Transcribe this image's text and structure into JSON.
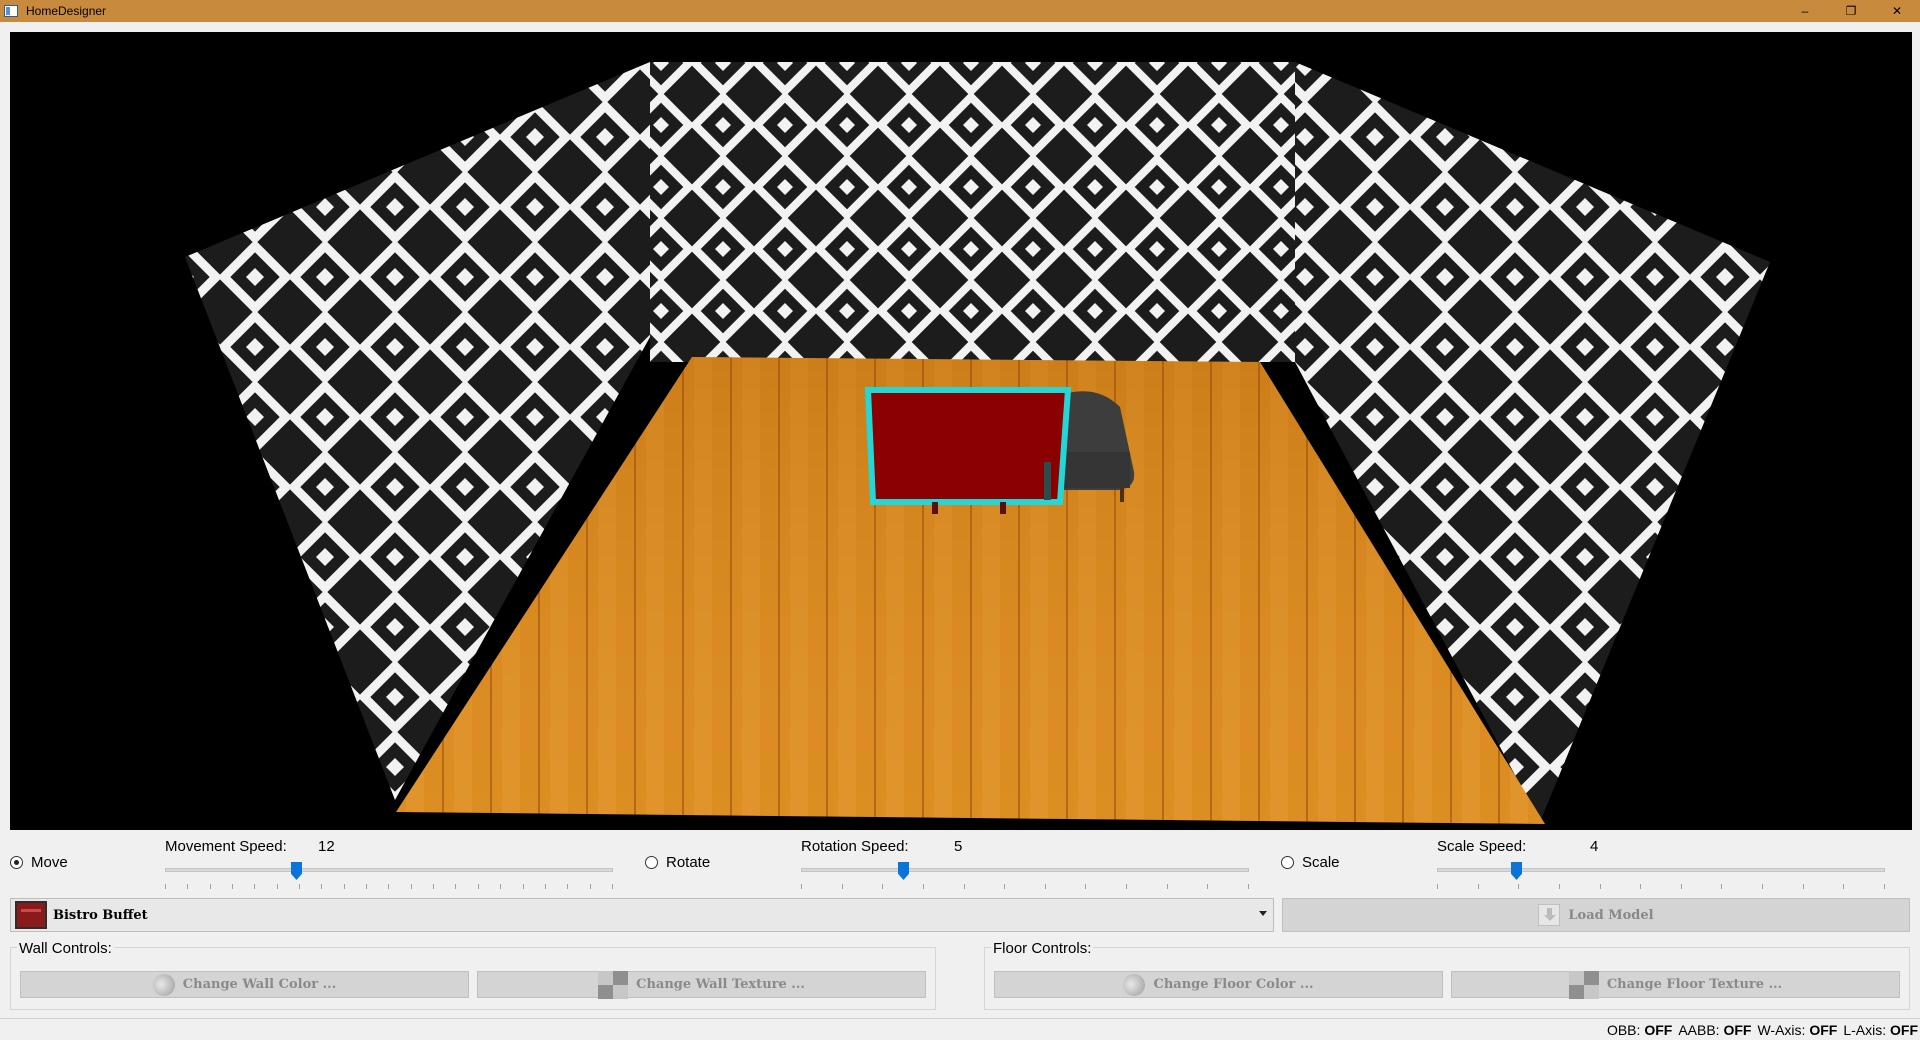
{
  "window": {
    "title": "HomeDesigner",
    "minimize": "–",
    "maximize": "❐",
    "close": "✕"
  },
  "controls": {
    "move": {
      "label": "Move",
      "checked": true
    },
    "movement_speed": {
      "label": "Movement Speed:",
      "value": "12"
    },
    "rotate": {
      "label": "Rotate",
      "checked": false
    },
    "rotation_speed": {
      "label": "Rotation Speed:",
      "value": "5"
    },
    "scale": {
      "label": "Scale",
      "checked": false
    },
    "scale_speed": {
      "label": "Scale Speed:",
      "value": "4"
    }
  },
  "model_select": {
    "selected": "Bistro Buffet"
  },
  "load_model": {
    "label": "Load Model"
  },
  "wall_controls": {
    "title": "Wall Controls:",
    "change_color": "Change Wall Color ...",
    "change_texture": "Change Wall Texture ..."
  },
  "floor_controls": {
    "title": "Floor Controls:",
    "change_color": "Change Floor Color ...",
    "change_texture": "Change Floor Texture ..."
  },
  "status": {
    "obb_label": "OBB:",
    "obb": "OFF",
    "aabb_label": "AABB:",
    "aabb": "OFF",
    "waxis_label": "W-Axis:",
    "waxis": "OFF",
    "laxis_label": "L-Axis:",
    "laxis": "OFF"
  },
  "colors": {
    "titlebar": "#c88b3e",
    "accent": "#0a74da",
    "selection": "#23d7d7"
  }
}
